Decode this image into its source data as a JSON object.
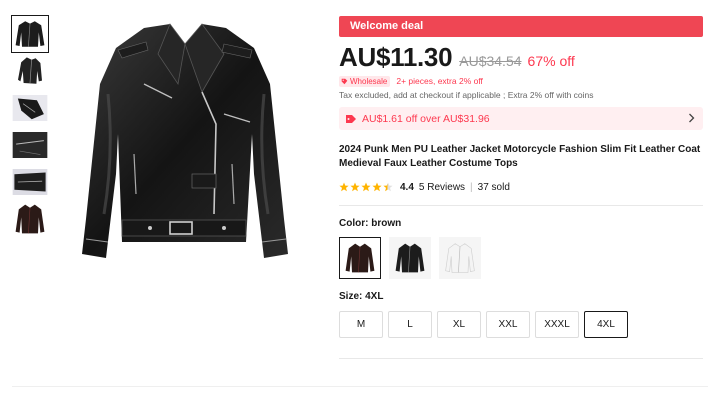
{
  "gallery": {
    "thumbnails": [
      {
        "name": "jacket-front",
        "selected": true
      },
      {
        "name": "jacket-angle",
        "selected": false
      },
      {
        "name": "jacket-sleeve-detail",
        "selected": false
      },
      {
        "name": "jacket-zipper-detail",
        "selected": false
      },
      {
        "name": "jacket-cuff-detail",
        "selected": false
      },
      {
        "name": "jacket-brown-front",
        "selected": false
      }
    ],
    "main_image": "black-leather-motorcycle-jacket"
  },
  "deal_banner": "Welcome deal",
  "price": {
    "current": "AU$11.30",
    "original": "AU$34.54",
    "discount": "67% off"
  },
  "wholesale": {
    "tag": "Wholesale",
    "text": "2+ pieces, extra 2% off"
  },
  "tax_note": "Tax excluded, add at checkout if applicable ; Extra 2% off with coins",
  "coupon": {
    "text": "AU$1.61 off over AU$31.96"
  },
  "product": {
    "title": "2024 Punk Men PU Leather Jacket Motorcycle Fashion Slim Fit Leather Coat Medieval Faux Leather Costume Tops",
    "rating": "4.4",
    "rating_value": 4.4,
    "reviews": "5 Reviews",
    "separator": "|",
    "sold": "37 sold"
  },
  "color": {
    "label": "Color:",
    "selected": "brown",
    "options": [
      "brown",
      "black",
      "white"
    ]
  },
  "size": {
    "label": "Size:",
    "selected": "4XL",
    "options": [
      "M",
      "L",
      "XL",
      "XXL",
      "XXXL",
      "4XL"
    ]
  },
  "colors": {
    "accent": "#fd384f",
    "banner": "#ef4654",
    "star": "#ffb400"
  }
}
